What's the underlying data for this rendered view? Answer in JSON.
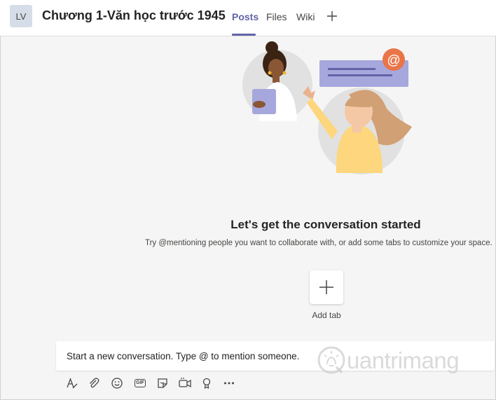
{
  "header": {
    "avatar_initials": "LV",
    "title": "Chương 1-Văn học trước 1945",
    "tabs": [
      {
        "label": "Posts",
        "active": true
      },
      {
        "label": "Files",
        "active": false
      },
      {
        "label": "Wiki",
        "active": false
      }
    ],
    "add_tab_icon": "plus-icon"
  },
  "empty_state": {
    "title": "Let's get the conversation started",
    "subtitle": "Try @mentioning people you want to collaborate with, or add some tabs to customize your space.",
    "add_tab_label": "Add tab",
    "illustration_icon": "at-mention-icon"
  },
  "composer": {
    "placeholder": "Start a new conversation. Type @ to mention someone.",
    "toolbar_icons": [
      "format-icon",
      "attach-icon",
      "emoji-icon",
      "gif-icon",
      "sticker-icon",
      "meet-now-icon",
      "praise-icon",
      "more-options-icon"
    ],
    "gif_label": "GIF"
  },
  "watermark": {
    "text": "uantrimang",
    "logo_letter": "Q"
  },
  "colors": {
    "accent": "#6264a7",
    "background": "#f5f5f5",
    "mention_badge": "#e97548",
    "card_purple": "#a6a7dc"
  }
}
